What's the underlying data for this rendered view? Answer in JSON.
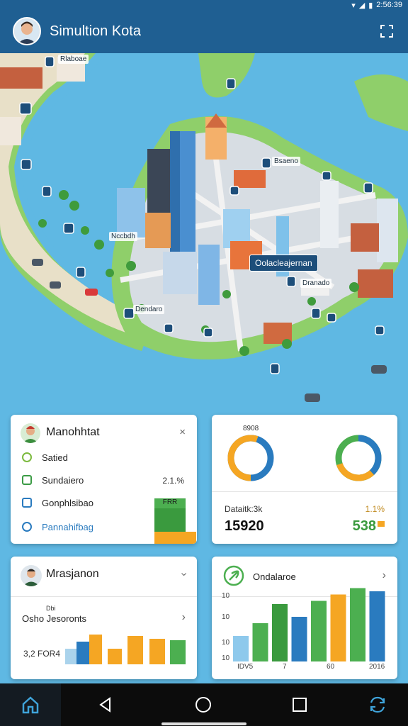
{
  "status": {
    "time": "2:56:39",
    "icons": [
      "wifi-icon",
      "signal-icon",
      "battery-icon"
    ]
  },
  "appbar": {
    "title": "Simultion Kota",
    "action_icon": "fullscreen-icon"
  },
  "map": {
    "callout": "Oolacleajernan",
    "labels": [
      "Rlaboae",
      "Bsaeno",
      "Dendaro",
      "Dranado",
      "Nccbdh"
    ]
  },
  "card_stats": {
    "title": "Manohhtat",
    "close": "×",
    "rows": [
      {
        "label": "Satied",
        "value": "",
        "icon": "check-circle-icon"
      },
      {
        "label": "Sundaiero",
        "value": "2.1.%",
        "icon": "square-icon"
      },
      {
        "label": "Gonphlsibao",
        "value": "",
        "icon": "image-icon"
      },
      {
        "label": "Pannahifbag",
        "value": "",
        "icon": "info-circle-icon"
      }
    ],
    "bar_tag": "FRR",
    "bar_fills": [
      0.35,
      0.85
    ]
  },
  "card_donut": {
    "top_label": "8908",
    "left_label": "Dataitk:3k",
    "left_value": "15920",
    "right_label": "1.1%",
    "right_value": "538",
    "donut1": [
      0.55,
      0.45
    ],
    "donut2": [
      0.38,
      0.32,
      0.3
    ]
  },
  "card_manager": {
    "title": "Mrasjanon",
    "subtitle_top": "Dbi",
    "subtitle": "Osho Jesoronts",
    "bottom_label": "3,2 FOR4",
    "chevron": "›"
  },
  "card_chart": {
    "title": "Ondalaroe",
    "ticks": [
      "10",
      "10",
      "10",
      "10"
    ],
    "x_labels": [
      "IDV5",
      "7",
      "60",
      "2016"
    ],
    "values": [
      4,
      6,
      9,
      7,
      9.5,
      10.5,
      11.5,
      11
    ]
  },
  "colors": {
    "accent": "#1f5f92",
    "green": "#4caf50",
    "blue": "#2a7bbf",
    "orange": "#f5a623",
    "water": "#5fb8e3"
  },
  "nav": [
    "home-icon",
    "back-icon",
    "home-circle-icon",
    "recents-icon",
    "sync-icon"
  ]
}
